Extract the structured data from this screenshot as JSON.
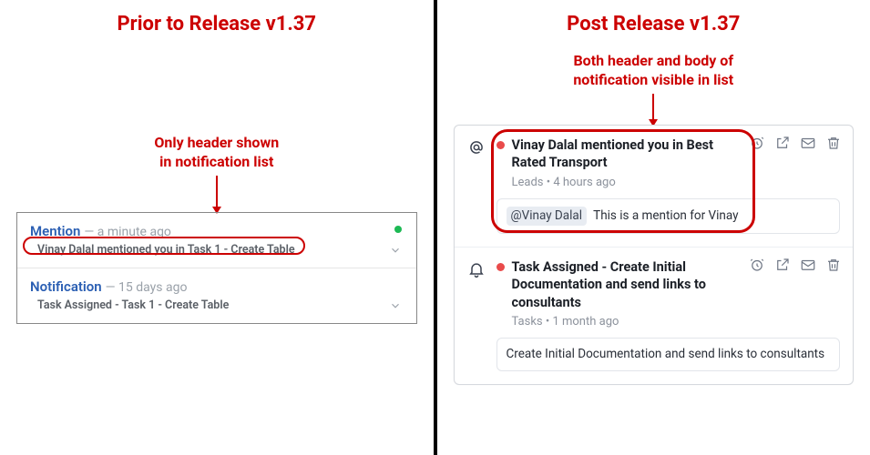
{
  "left": {
    "title": "Prior to Release v1.37",
    "annotation": "Only header shown\nin notification list",
    "items": [
      {
        "type": "Mention",
        "time": "— a minute ago",
        "line": "Vinay Dalal mentioned you in Task 1 - Create Table",
        "unread": true
      },
      {
        "type": "Notification",
        "time": "— 15 days ago",
        "line": "Task Assigned - Task 1 - Create Table",
        "unread": false
      }
    ]
  },
  "right": {
    "title": "Post Release v1.37",
    "annotation": "Both header and body of\nnotification visible in list",
    "items": [
      {
        "icon": "at",
        "header": "Vinay Dalal mentioned you in Best Rated Transport",
        "meta": "Leads • 4 hours ago",
        "body_mention": "@Vinay Dalal",
        "body_text": "This is a mention for Vinay"
      },
      {
        "icon": "bell",
        "header": "Task Assigned - Create Initial Documentation and send links to consultants",
        "meta": "Tasks • 1 month ago",
        "body_text": "Create Initial Documentation and send links to consultants"
      }
    ]
  }
}
